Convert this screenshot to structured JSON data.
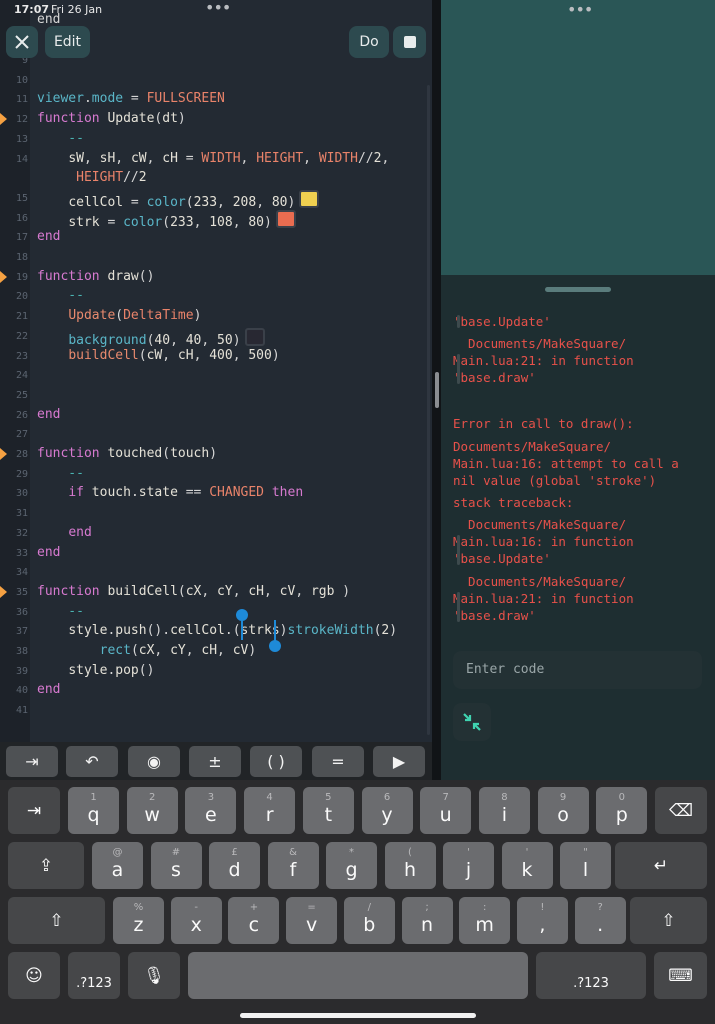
{
  "status": {
    "time": "17:07",
    "date": "Fri 26 Jan"
  },
  "toolbar": {
    "close_icon": "close-icon",
    "edit_label": "Edit",
    "do_label": "Do",
    "stop_icon": "stop-icon"
  },
  "top_fragment": "end",
  "code_lines": [
    {
      "n": "9",
      "text": ""
    },
    {
      "n": "10",
      "text": ""
    },
    {
      "n": "11",
      "text": "viewer.mode = FULLSCREEN"
    },
    {
      "n": "12",
      "text": "function Update(dt)",
      "marker": true
    },
    {
      "n": "13",
      "text": "    --"
    },
    {
      "n": "14",
      "text": "    sW, sH, cW, cH = WIDTH, HEIGHT, WIDTH//2,"
    },
    {
      "n": "",
      "text": "     HEIGHT//2"
    },
    {
      "n": "15",
      "text": "    cellCol = color(233, 208, 80)",
      "swatch": "#f0d050"
    },
    {
      "n": "16",
      "text": "    strk = color(233, 108, 80)",
      "swatch": "#e96c50"
    },
    {
      "n": "17",
      "text": "end"
    },
    {
      "n": "18",
      "text": ""
    },
    {
      "n": "19",
      "text": "function draw()",
      "marker": true
    },
    {
      "n": "20",
      "text": "    --"
    },
    {
      "n": "21",
      "text": "    Update(DeltaTime)"
    },
    {
      "n": "22",
      "text": "    background(40, 40, 50)",
      "swatch": "#282832"
    },
    {
      "n": "23",
      "text": "    buildCell(cW, cH, 400, 500)"
    },
    {
      "n": "24",
      "text": ""
    },
    {
      "n": "25",
      "text": ""
    },
    {
      "n": "26",
      "text": "end"
    },
    {
      "n": "27",
      "text": ""
    },
    {
      "n": "28",
      "text": "function touched(touch)",
      "marker": true
    },
    {
      "n": "29",
      "text": "    --"
    },
    {
      "n": "30",
      "text": "    if touch.state == CHANGED then"
    },
    {
      "n": "31",
      "text": ""
    },
    {
      "n": "32",
      "text": "    end"
    },
    {
      "n": "33",
      "text": "end"
    },
    {
      "n": "34",
      "text": ""
    },
    {
      "n": "35",
      "text": "function buildCell(cX, cY, cH, cV, rgb )",
      "marker": true
    },
    {
      "n": "36",
      "text": "    --"
    },
    {
      "n": "37",
      "text": "    style.push().cellCol.(strks)strokeWidth(2)"
    },
    {
      "n": "38",
      "text": "        rect(cX, cY, cH, cV)"
    },
    {
      "n": "39",
      "text": "    style.pop()"
    },
    {
      "n": "40",
      "text": "end"
    },
    {
      "n": "41",
      "text": ""
    }
  ],
  "console": {
    "messages": [
      {
        "text": "'base.Update'",
        "indent": true
      },
      {
        "text": "  Documents/MakeSquare/\nMain.lua:21: in function\n'base.draw'",
        "indent": true
      },
      {
        "text": "Error in call to draw():",
        "indent": false
      },
      {
        "text": "Documents/MakeSquare/\nMain.lua:16: attempt to call a\nnil value (global 'stroke')",
        "indent": false
      },
      {
        "text": "stack traceback:",
        "indent": false
      },
      {
        "text": "  Documents/MakeSquare/\nMain.lua:16: in function\n'base.Update'",
        "indent": true
      },
      {
        "text": "  Documents/MakeSquare/\nMain.lua:21: in function\n'base.draw'",
        "indent": true
      }
    ],
    "input_placeholder": "Enter code",
    "collapse_icon": "collapse-icon"
  },
  "accessory_tools": [
    {
      "name": "indent-tool",
      "glyph": "⇥"
    },
    {
      "name": "undo-tool",
      "glyph": "↶"
    },
    {
      "name": "preview-tool",
      "glyph": "◉"
    },
    {
      "name": "operators-tool",
      "glyph": "±"
    },
    {
      "name": "parentheses-tool",
      "glyph": "( )"
    },
    {
      "name": "equals-tool",
      "glyph": "="
    },
    {
      "name": "run-tool",
      "glyph": "▶"
    }
  ],
  "keyboard": {
    "row1": [
      {
        "sub": "1",
        "main": "q"
      },
      {
        "sub": "2",
        "main": "w"
      },
      {
        "sub": "3",
        "main": "e"
      },
      {
        "sub": "4",
        "main": "r"
      },
      {
        "sub": "5",
        "main": "t"
      },
      {
        "sub": "6",
        "main": "y"
      },
      {
        "sub": "7",
        "main": "u"
      },
      {
        "sub": "8",
        "main": "i"
      },
      {
        "sub": "9",
        "main": "o"
      },
      {
        "sub": "0",
        "main": "p"
      }
    ],
    "row2": [
      {
        "sub": "@",
        "main": "a"
      },
      {
        "sub": "#",
        "main": "s"
      },
      {
        "sub": "£",
        "main": "d"
      },
      {
        "sub": "&",
        "main": "f"
      },
      {
        "sub": "*",
        "main": "g"
      },
      {
        "sub": "(",
        "main": "h"
      },
      {
        "sub": "'",
        "main": "j"
      },
      {
        "sub": "'",
        "main": "k"
      },
      {
        "sub": "\"",
        "main": "l"
      }
    ],
    "row3": [
      {
        "sub": "%",
        "main": "z"
      },
      {
        "sub": "-",
        "main": "x"
      },
      {
        "sub": "+",
        "main": "c"
      },
      {
        "sub": "=",
        "main": "v"
      },
      {
        "sub": "/",
        "main": "b"
      },
      {
        "sub": ";",
        "main": "n"
      },
      {
        "sub": ":",
        "main": "m"
      },
      {
        "sub": "!",
        "main": ","
      },
      {
        "sub": "?",
        "main": "."
      }
    ],
    "num_label": ".?123",
    "tab_icon": "tab-icon",
    "delete_icon": "delete-icon",
    "caps_icon": "caps-lock-icon",
    "return_icon": "return-icon",
    "shift_icon": "shift-icon",
    "emoji_icon": "emoji-icon",
    "mic_icon": "microphone-icon",
    "hide_keyboard_icon": "hide-keyboard-icon"
  }
}
